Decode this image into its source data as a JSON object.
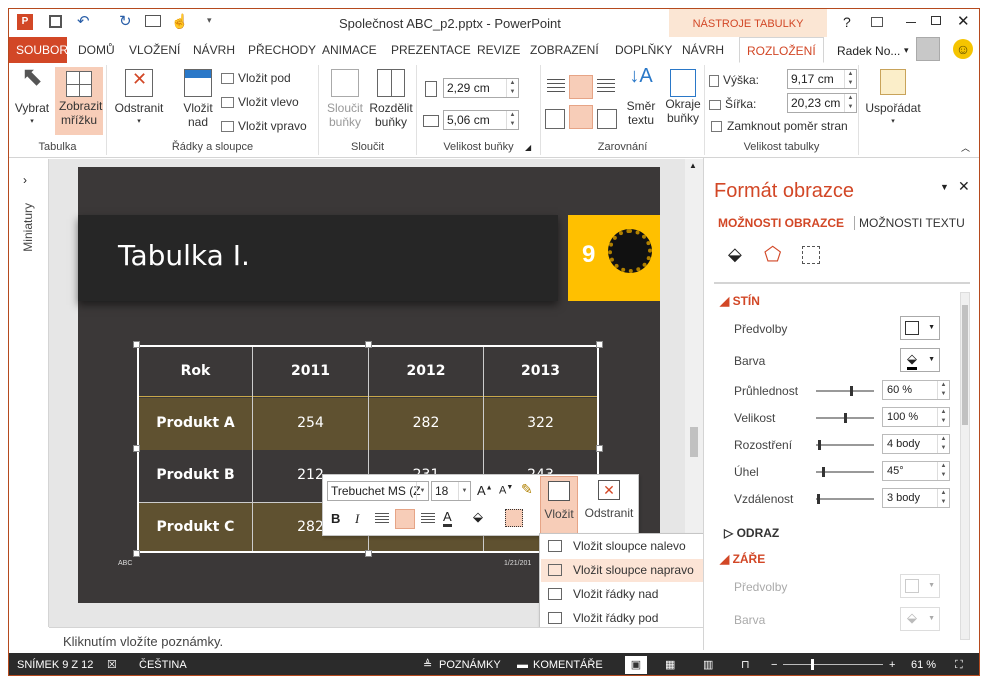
{
  "app": {
    "title": "Společnost ABC_p2.pptx - PowerPoint",
    "context_group": "NÁSTROJE TABULKY",
    "user": "Radek No..."
  },
  "tabs": [
    "SOUBOR",
    "DOMŮ",
    "VLOŽENÍ",
    "NÁVRH",
    "PŘECHODY",
    "ANIMACE",
    "PREZENTACE",
    "REVIZE",
    "ZOBRAZENÍ",
    "DOPLŇKY",
    "NÁVRH",
    "ROZLOŽENÍ"
  ],
  "ribbon": {
    "tabulka": {
      "label": "Tabulka",
      "vybrat": "Vybrat",
      "zobrazit": "Zobrazit mřížku"
    },
    "radky": {
      "label": "Řádky a sloupce",
      "odstranit": "Odstranit",
      "vlozit_nad": "Vložit nad",
      "vlozit_pod": "Vložit pod",
      "vlozit_vlevo": "Vložit vlevo",
      "vlozit_vpravo": "Vložit vpravo"
    },
    "sloucit": {
      "label": "Sloučit",
      "sloucit_bunky": "Sloučit buňky",
      "rozdelit": "Rozdělit buňky"
    },
    "velikost_bunky": {
      "label": "Velikost buňky",
      "height": "2,29 cm",
      "width": "5,06 cm"
    },
    "zarovnani": {
      "label": "Zarovnání",
      "smer": "Směr textu",
      "okraje": "Okraje buňky"
    },
    "velikost_tabulky": {
      "label": "Velikost tabulky",
      "vyska_label": "Výška:",
      "vyska": "9,17 cm",
      "sirka_label": "Šířka:",
      "sirka": "20,23 cm",
      "zamknout": "Zamknout poměr stran"
    },
    "usporadat": {
      "label": "Uspořádat"
    }
  },
  "sidebar": {
    "label": "Miniatury"
  },
  "slide": {
    "title": "Tabulka I.",
    "number": "9",
    "footer_left": "ABC",
    "footer_date": "1/21/201",
    "table": {
      "header": [
        "Rok",
        "2011",
        "2012",
        "2013"
      ],
      "rows": [
        [
          "Produkt A",
          "254",
          "282",
          "322"
        ],
        [
          "Produkt B",
          "212",
          "231",
          "243"
        ],
        [
          "Produkt C",
          "282",
          "",
          ""
        ]
      ]
    }
  },
  "mini_toolbar": {
    "font": "Trebuchet MS (Z",
    "size": "18",
    "vlozit": "Vložit",
    "odstranit": "Odstranit"
  },
  "insert_menu": [
    "Vložit sloupce nalevo",
    "Vložit sloupce napravo",
    "Vložit řádky nad",
    "Vložit řádky pod"
  ],
  "notes": {
    "placeholder": "Kliknutím vložíte poznámky."
  },
  "pane": {
    "title": "Formát obrazce",
    "tab1": "MOŽNOSTI OBRAZCE",
    "tab2": "MOŽNOSTI TEXTU",
    "stin": "STÍN",
    "predvolby": "Předvolby",
    "barva": "Barva",
    "pruhlednost": "Průhlednost",
    "pruhlednost_val": "60 %",
    "velikost": "Velikost",
    "velikost_val": "100 %",
    "rozostreni": "Rozostření",
    "rozostreni_val": "4 body",
    "uhel": "Úhel",
    "uhel_val": "45°",
    "vzdalenost": "Vzdálenost",
    "vzdalenost_val": "3 body",
    "odraz": "ODRAZ",
    "zare": "ZÁŘE",
    "predvolby2": "Předvolby",
    "barva2": "Barva"
  },
  "status": {
    "slide": "SNÍMEK 9 Z 12",
    "lang": "ČEŠTINA",
    "poznamky": "POZNÁMKY",
    "komentare": "KOMENTÁŘE",
    "zoom": "61 %"
  },
  "colors": {
    "accent": "#D24726",
    "tableRow": "#5F5130",
    "slideBg": "#3B3838",
    "numBox": "#FFC000"
  }
}
